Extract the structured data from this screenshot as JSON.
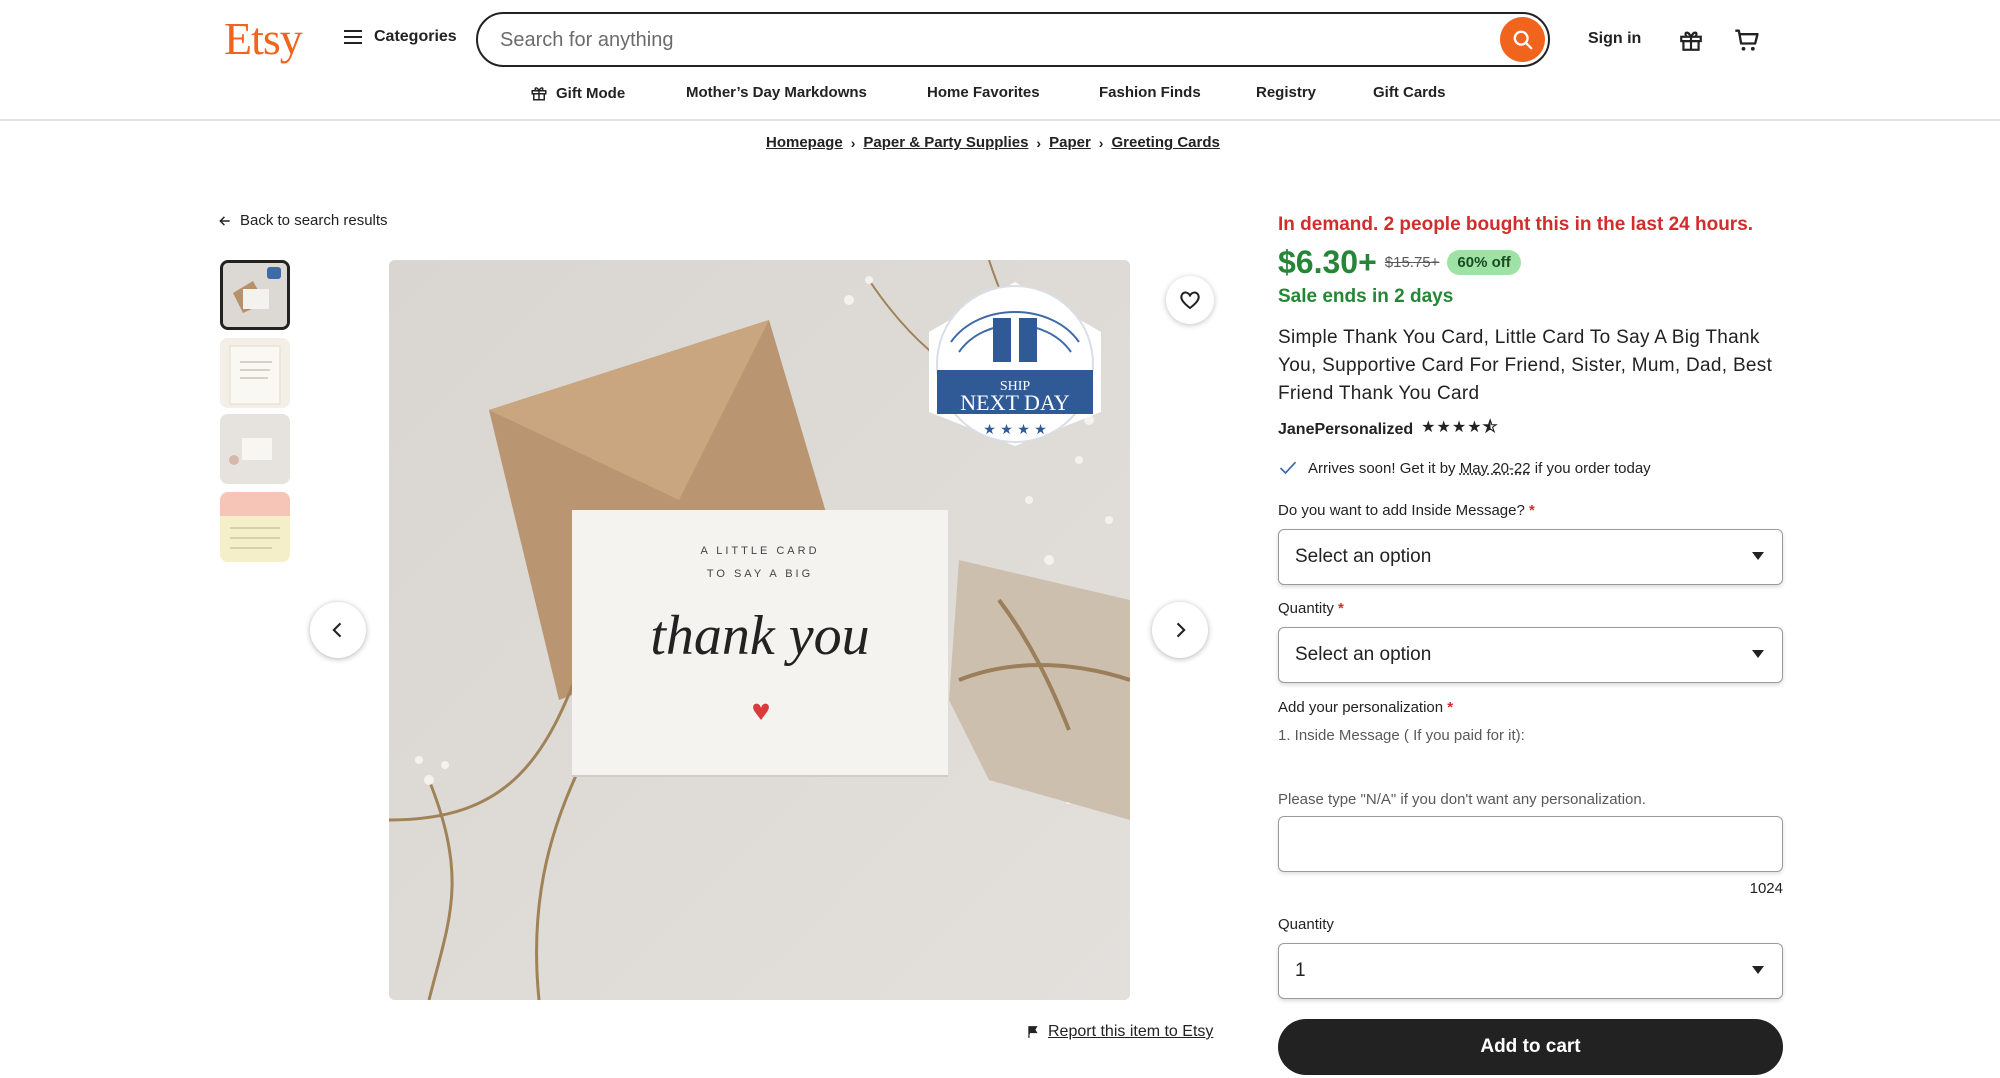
{
  "header": {
    "logo": "Etsy",
    "categories_label": "Categories",
    "search_placeholder": "Search for anything",
    "signin_label": "Sign in"
  },
  "nav": {
    "items": [
      "Gift Mode",
      "Mother’s Day Markdowns",
      "Home Favorites",
      "Fashion Finds",
      "Registry",
      "Gift Cards"
    ]
  },
  "breadcrumb": [
    "Homepage",
    "Paper & Party Supplies",
    "Paper",
    "Greeting Cards"
  ],
  "back_link": "Back to search results",
  "product_image": {
    "card_line1": "A LITTLE CARD",
    "card_line2": "TO SAY A BIG",
    "card_script": "thank you",
    "badge_top": "SHIP",
    "badge_main": "NEXT DAY"
  },
  "report_link": "Report this item to Etsy",
  "listing": {
    "demand": "In demand. 2 people bought this in the last 24 hours.",
    "price": "$6.30+",
    "original_price": "$15.75+",
    "discount": "60% off",
    "sale_ends": "Sale ends in 2 days",
    "title": "Simple Thank You Card, Little Card To Say A Big Thank You, Supportive Card For Friend, Sister, Mum, Dad, Best Friend Thank You Card",
    "shop_name": "JanePersonalized",
    "rating": 4.5,
    "stars": "★★★★⯪",
    "arrives_prefix": "Arrives soon! Get it by",
    "arrives_date": "May 20-22",
    "arrives_suffix": "if you order today"
  },
  "form": {
    "inside_message_label": "Do you want to add Inside Message?",
    "inside_message_value": "Select an option",
    "quantity_label": "Quantity",
    "quantity_value": "Select an option",
    "personalization_label": "Add your personalization",
    "personalization_instruction": "1. Inside Message ( If you paid for it):",
    "personalization_hint": "Please type \"N/A\" if you don't want any personalization.",
    "char_count": "1024",
    "qty_label": "Quantity",
    "qty_value": "1",
    "required_mark": "*"
  },
  "add_to_cart": "Add to cart",
  "colors": {
    "brand": "#f1641e",
    "demand": "#d12d2d",
    "price": "#258635",
    "discount_bg": "#9ee3a5",
    "button": "#222222"
  }
}
